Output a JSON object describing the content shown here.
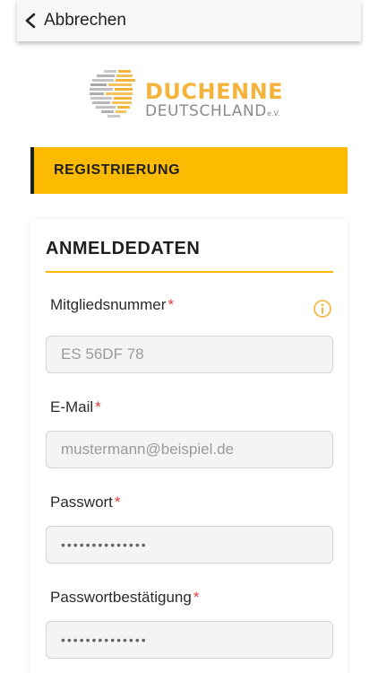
{
  "nav": {
    "back_label": "Abbrechen"
  },
  "logo": {
    "title": "DUCHENNE",
    "subtitle": "DEUTSCHLAND",
    "suffix": "e.V."
  },
  "banner": {
    "label": "REGISTRIERUNG"
  },
  "form": {
    "section_title": "ANMELDEDATEN",
    "required_mark": "*",
    "fields": [
      {
        "label": "Mitgliedsnummer",
        "placeholder": "ES 56DF 78"
      },
      {
        "label": "E-Mail",
        "placeholder": "mustermann@beispiel.de"
      },
      {
        "label": "Passwort",
        "value": "••••••••••••••"
      },
      {
        "label": "Passwortbestätigung",
        "value": "••••••••••••••"
      }
    ]
  },
  "colors": {
    "accent": "#fcba00",
    "logo_orange": "#f4b33a",
    "required": "#e33a3a"
  },
  "icons": {
    "back": "chevron-left-icon",
    "info": "info-circle-icon"
  }
}
